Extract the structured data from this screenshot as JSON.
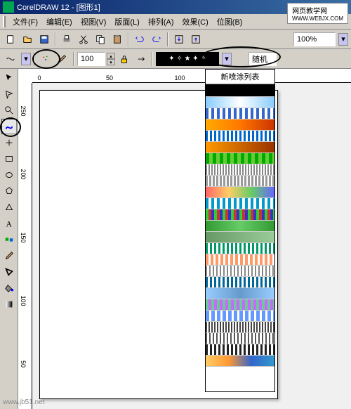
{
  "app": {
    "name": "CorelDRAW 12",
    "document": "[图形1]"
  },
  "menu": {
    "file": "文件(F)",
    "edit": "编辑(E)",
    "view": "视图(V)",
    "layout": "版面(L)",
    "arrange": "排列(A)",
    "effects": "效果(C)",
    "bitmaps": "位图(B)"
  },
  "toolbar_main": {
    "zoom": "100%"
  },
  "toolbar_spray": {
    "size": "100",
    "spray_label": "新喷涂列表",
    "mode": "随机"
  },
  "ruler": {
    "h_marks": [
      "0",
      "50",
      "100"
    ],
    "v_marks": [
      "50",
      "100",
      "150",
      "200",
      "250"
    ]
  },
  "spraylist": {
    "header": "新喷涂列表"
  },
  "watermark": "网页教学网",
  "watermark_url": "WWW.WEBJX.COM",
  "watermark2": "www.jb51.net"
}
